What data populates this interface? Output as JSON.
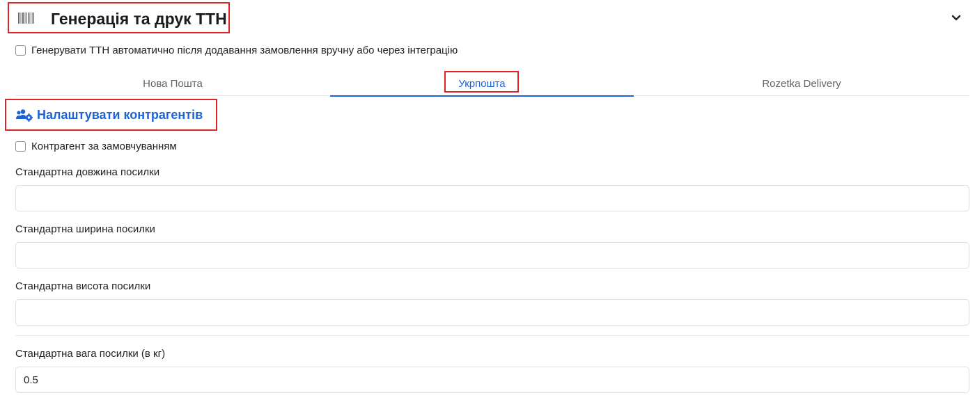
{
  "header": {
    "title": "Генерація та друк ТТН",
    "icon": "barcode-icon",
    "toggle_icon": "chevron-down-icon"
  },
  "auto_generate": {
    "label": "Генерувати ТТН автоматично після додавання замовлення вручну або через інтеграцію",
    "checked": false
  },
  "tabs": [
    {
      "label": "Нова Пошта",
      "active": false
    },
    {
      "label": "Укрпошта",
      "active": true
    },
    {
      "label": "Rozetka Delivery",
      "active": false
    }
  ],
  "contragents": {
    "label": "Налаштувати контрагентів",
    "icon": "users-gear-icon"
  },
  "default_contragent": {
    "label": "Контрагент за замовчуванням",
    "checked": false
  },
  "fields": [
    {
      "label": "Стандартна довжина посилки",
      "value": ""
    },
    {
      "label": "Стандартна ширина посилки",
      "value": ""
    },
    {
      "label": "Стандартна висота посилки",
      "value": ""
    },
    {
      "label": "Стандартна вага посилки (в кг)",
      "value": "0.5"
    }
  ],
  "colors": {
    "accent": "#1d63d6",
    "highlight": "#e02424"
  }
}
